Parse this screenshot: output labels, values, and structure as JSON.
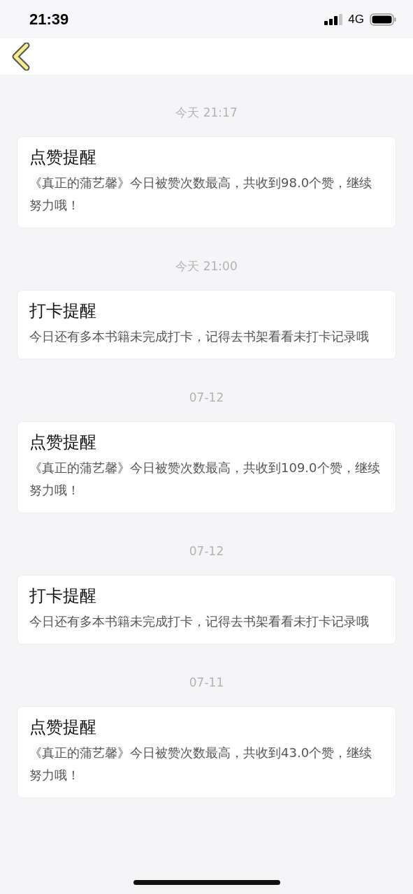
{
  "status_bar": {
    "time": "21:39",
    "network": "4G"
  },
  "messages": [
    {
      "time": "今天 21:17",
      "title": "点赞提醒",
      "body": "《真正的蒲艺馨》今日被赞次数最高，共收到98.0个赞，继续努力哦！"
    },
    {
      "time": "今天 21:00",
      "title": "打卡提醒",
      "body": "今日还有多本书籍未完成打卡，记得去书架看看未打卡记录哦"
    },
    {
      "time": "07-12",
      "title": "点赞提醒",
      "body": "《真正的蒲艺馨》今日被赞次数最高，共收到109.0个赞，继续努力哦！"
    },
    {
      "time": "07-12",
      "title": "打卡提醒",
      "body": "今日还有多本书籍未完成打卡，记得去书架看看未打卡记录哦"
    },
    {
      "time": "07-11",
      "title": "点赞提醒",
      "body": "《真正的蒲艺馨》今日被赞次数最高，共收到43.0个赞，继续努力哦！"
    }
  ]
}
